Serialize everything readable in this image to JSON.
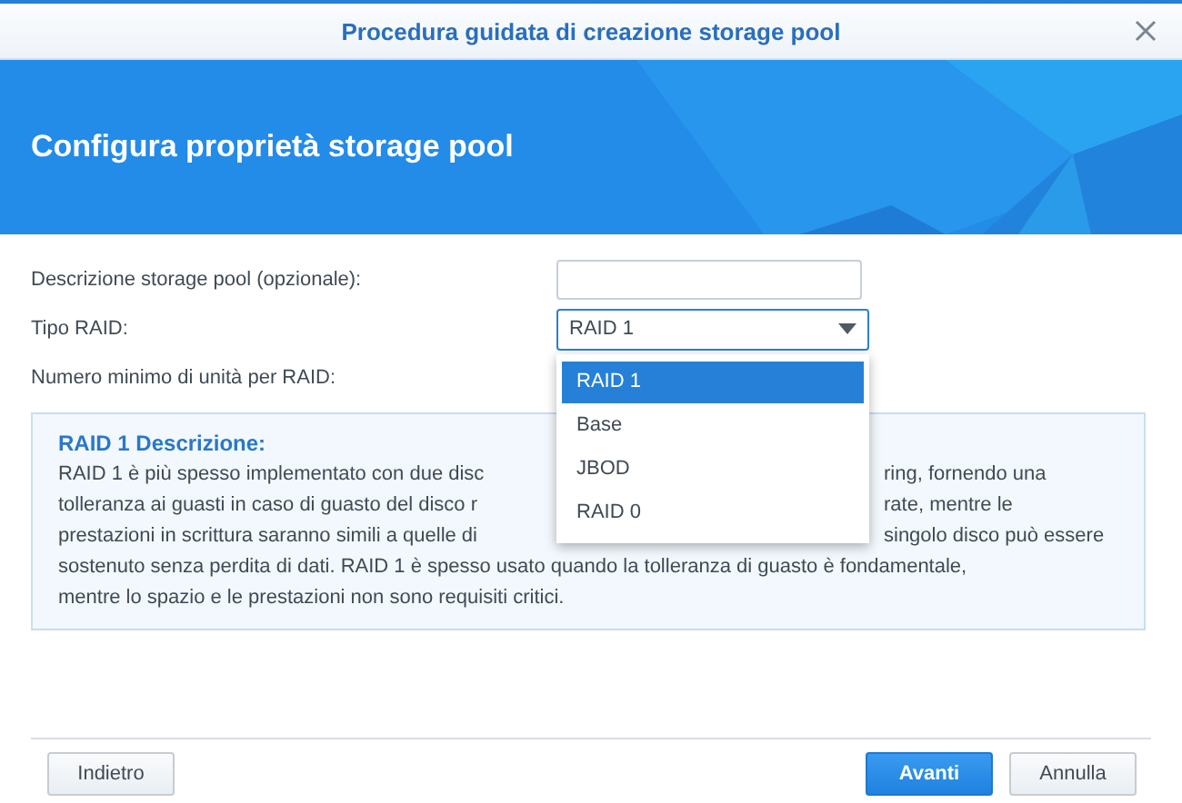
{
  "window": {
    "title": "Procedura guidata di creazione storage pool"
  },
  "header": {
    "title": "Configura proprietà storage pool"
  },
  "form": [
    {
      "kind": "text",
      "label": "Descrizione storage pool (opzionale):"
    },
    {
      "kind": "select",
      "label": "Tipo RAID:",
      "value": "RAID 1",
      "expanded": true,
      "options": [
        {
          "label": "RAID 1",
          "selected": true
        },
        {
          "label": "Base",
          "selected": false
        },
        {
          "label": "JBOD",
          "selected": false
        },
        {
          "label": "RAID 0",
          "selected": false
        }
      ]
    },
    {
      "kind": "label",
      "label": "Numero minimo di unità per RAID:"
    }
  ],
  "description": {
    "title": "RAID 1 Descrizione:",
    "lines": [
      {
        "left": "RAID 1 è più spesso implementato con due disc",
        "right": "ring, fornendo una"
      },
      {
        "left": "tolleranza ai guasti in caso di guasto del disco r",
        "right": "rate, mentre le"
      },
      {
        "left": "prestazioni in scrittura saranno simili a quelle di",
        "right": "singolo disco può essere"
      },
      {
        "left": "sostenuto senza perdita di dati. RAID 1 è spesso usato quando la tolleranza di guasto è fondamentale,"
      },
      {
        "left": "mentre lo spazio e le prestazioni non sono requisiti critici."
      }
    ]
  },
  "footer": {
    "back": "Indietro",
    "next": "Avanti",
    "cancel": "Annulla"
  }
}
